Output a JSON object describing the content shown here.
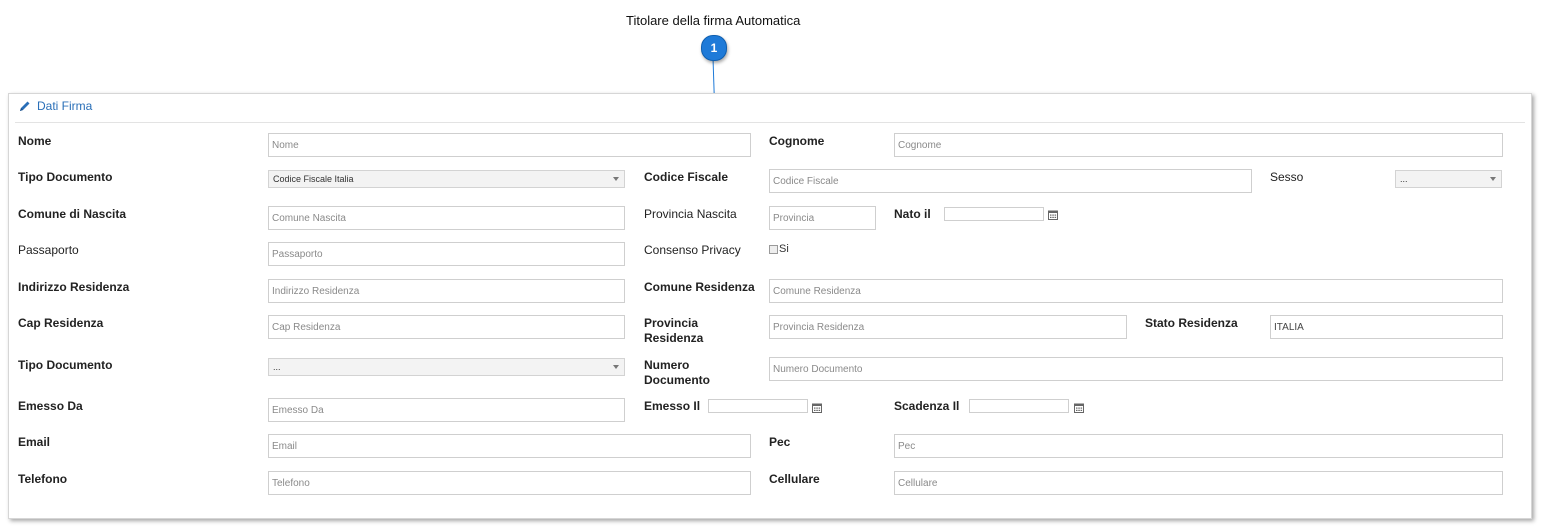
{
  "callout": {
    "title": "Titolare della firma Automatica",
    "badge": "1"
  },
  "panel": {
    "title": "Dati Firma",
    "icon": "pencil-icon"
  },
  "form": {
    "nome": {
      "label": "Nome",
      "placeholder": "Nome"
    },
    "cognome": {
      "label": "Cognome",
      "placeholder": "Cognome"
    },
    "tipo_documento_1": {
      "label": "Tipo Documento",
      "value": "Codice Fiscale Italia"
    },
    "codice_fiscale": {
      "label": "Codice Fiscale",
      "placeholder": "Codice Fiscale"
    },
    "sesso": {
      "label": "Sesso",
      "value": "..."
    },
    "comune_nascita": {
      "label": "Comune di Nascita",
      "placeholder": "Comune Nascita"
    },
    "provincia_nascita": {
      "label": "Provincia Nascita",
      "placeholder": "Provincia"
    },
    "nato_il": {
      "label": "Nato il"
    },
    "passaporto": {
      "label": "Passaporto",
      "placeholder": "Passaporto"
    },
    "consenso_privacy": {
      "label": "Consenso Privacy",
      "option": "Si"
    },
    "indirizzo_residenza": {
      "label": "Indirizzo Residenza",
      "placeholder": "Indirizzo Residenza"
    },
    "comune_residenza": {
      "label": "Comune Residenza",
      "placeholder": "Comune Residenza"
    },
    "cap_residenza": {
      "label": "Cap Residenza",
      "placeholder": "Cap Residenza"
    },
    "provincia_residenza": {
      "label_1": "Provincia",
      "label_2": "Residenza",
      "placeholder": "Provincia Residenza"
    },
    "stato_residenza": {
      "label": "Stato Residenza",
      "value": "ITALIA"
    },
    "tipo_documento_2": {
      "label": "Tipo Documento",
      "value": "..."
    },
    "numero_documento": {
      "label_1": "Numero",
      "label_2": "Documento",
      "placeholder": "Numero Documento"
    },
    "emesso_da": {
      "label": "Emesso Da",
      "placeholder": "Emesso Da"
    },
    "emesso_il": {
      "label": "Emesso Il"
    },
    "scadenza_il": {
      "label": "Scadenza Il"
    },
    "email": {
      "label": "Email",
      "placeholder": "Email"
    },
    "pec": {
      "label": "Pec",
      "placeholder": "Pec"
    },
    "telefono": {
      "label": "Telefono",
      "placeholder": "Telefono"
    },
    "cellulare": {
      "label": "Cellulare",
      "placeholder": "Cellulare"
    }
  },
  "colors": {
    "accent": "#2a6fb8",
    "badge": "#1e7ad8"
  }
}
